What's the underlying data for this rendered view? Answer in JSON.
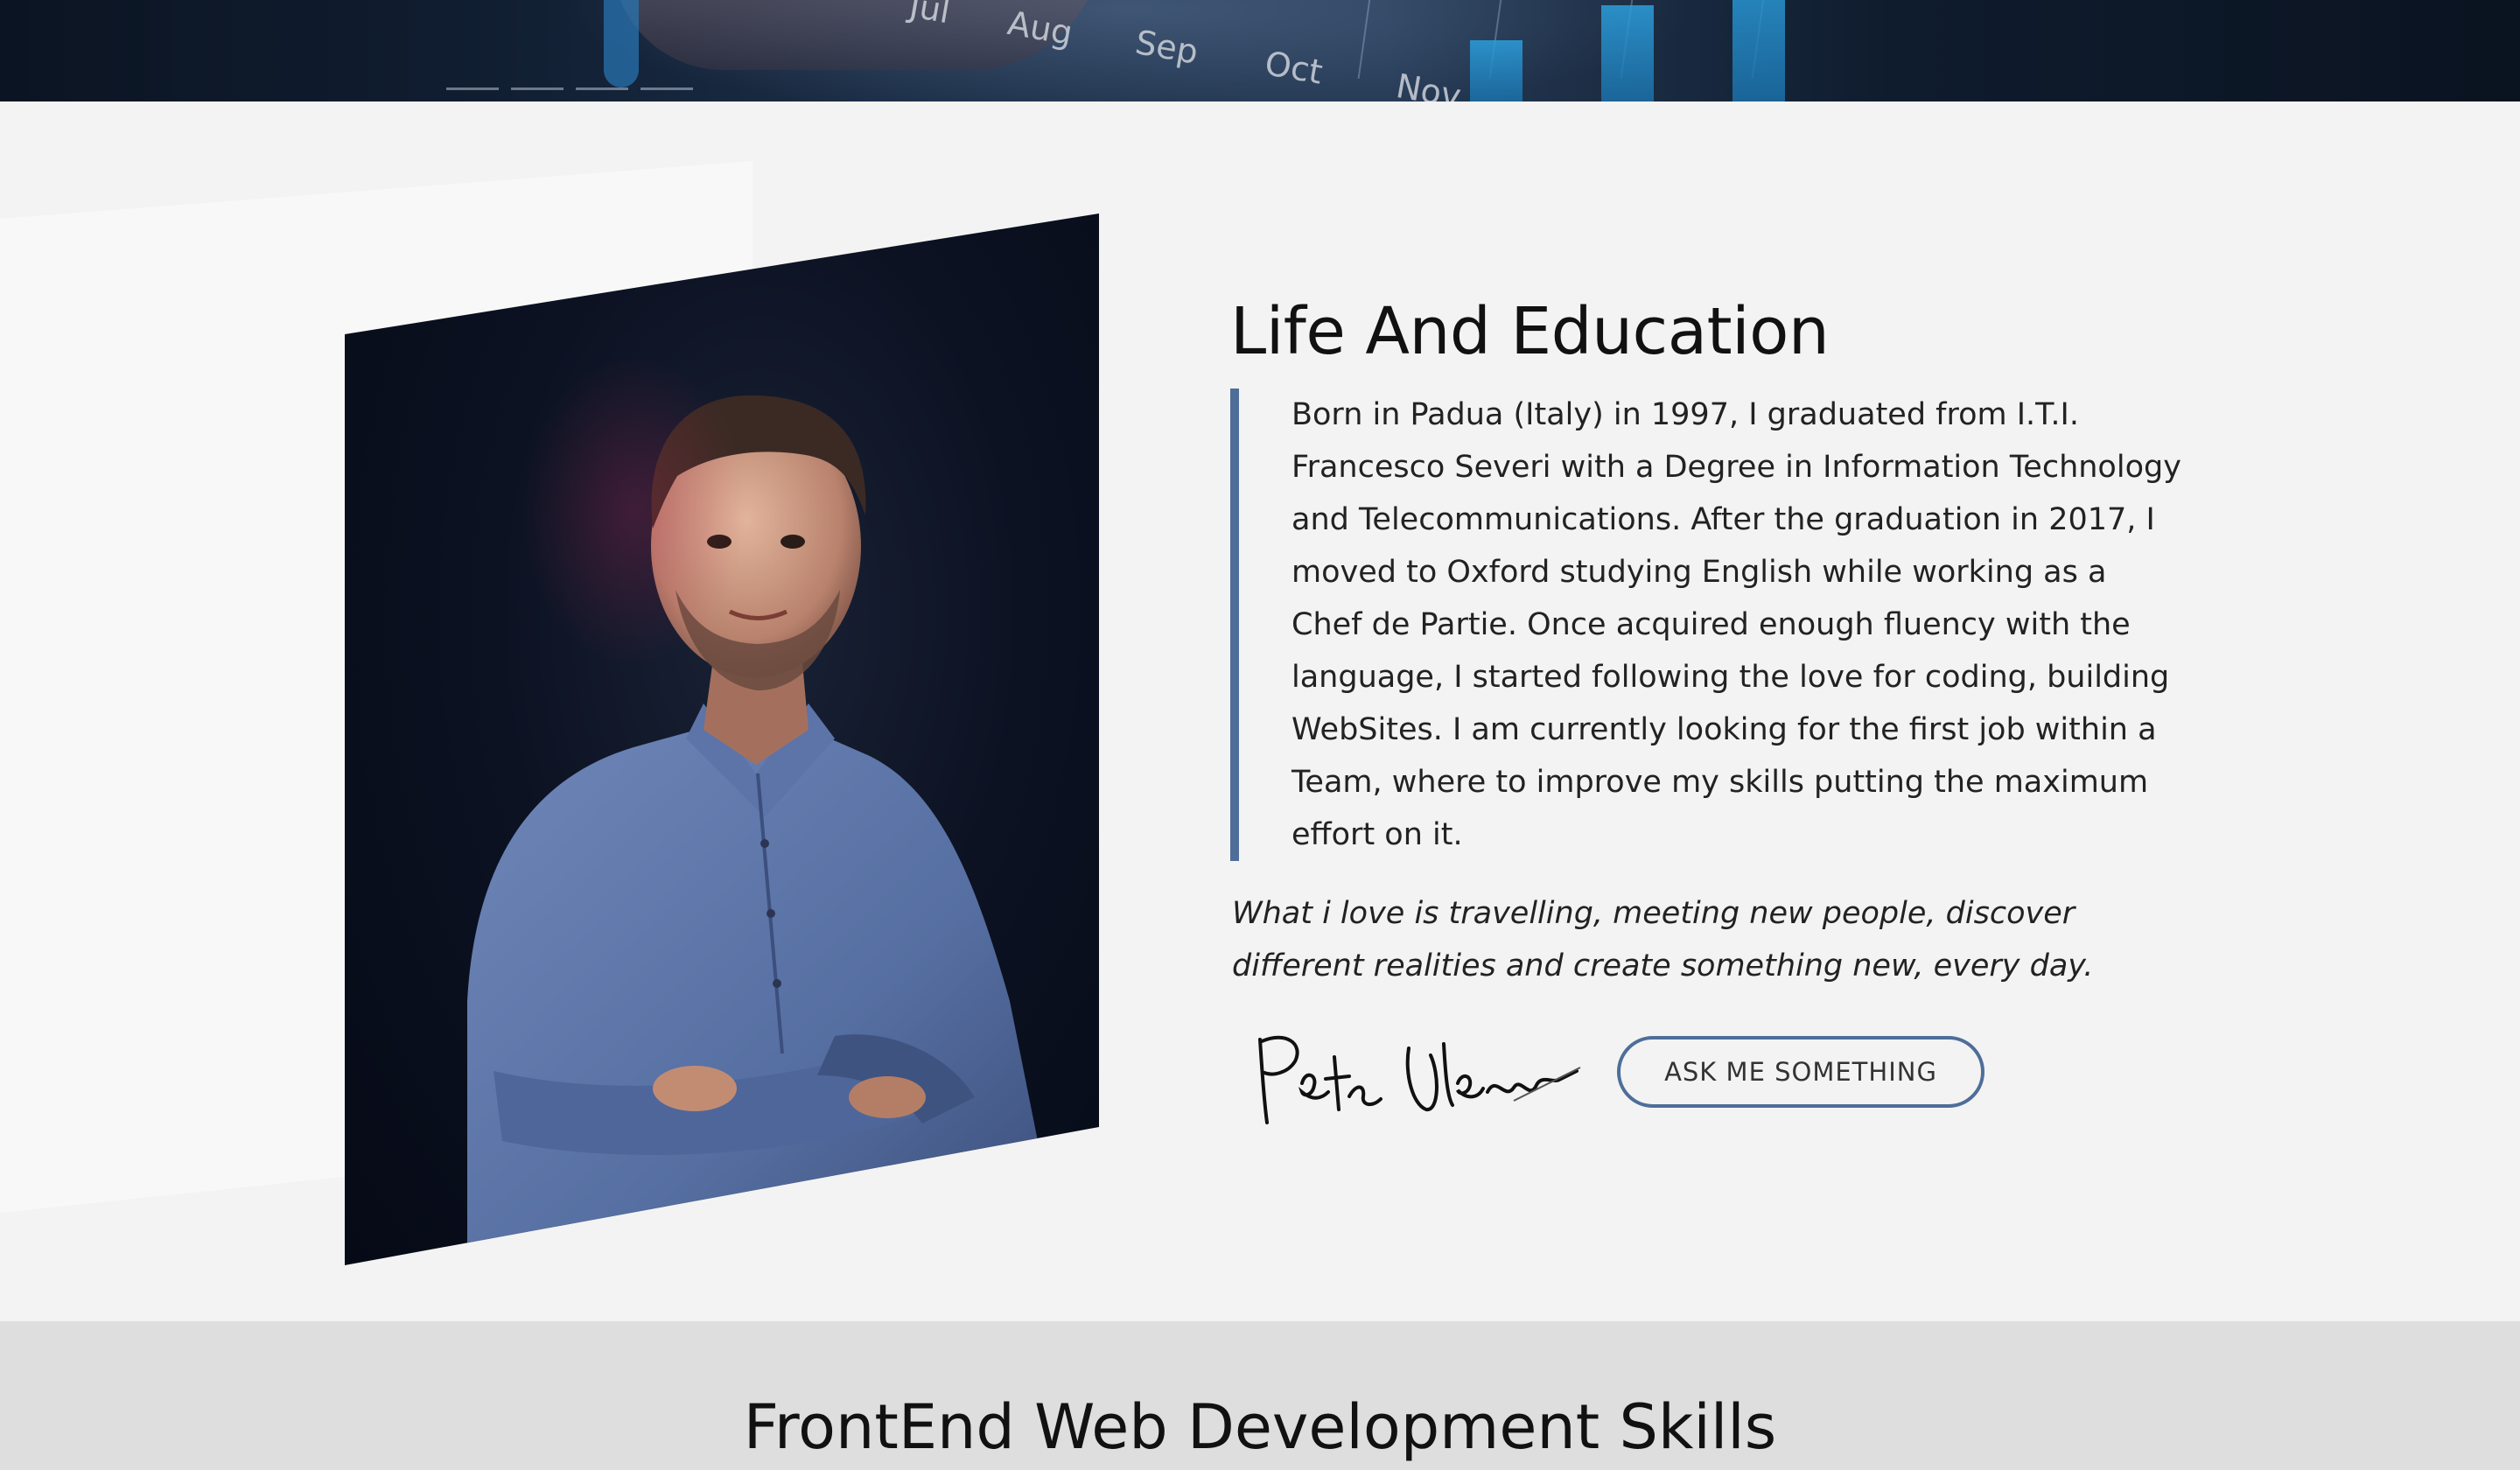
{
  "hero": {
    "months": [
      "Jul",
      "Aug",
      "Sep",
      "Oct",
      "Nov"
    ]
  },
  "about": {
    "title": "Life And Education",
    "bio": "Born in Padua (Italy) in 1997, I graduated from I.T.I. Francesco Severi with a Degree in Information Technology and Telecommunications. After the graduation in 2017, I moved to Oxford studying English while working as a Chef de Partie. Once acquired enough fluency with the language, I started following the love for coding, building WebSites. I am currently looking for the first job within a Team, where to improve my skills putting the maximum effort on it.",
    "love": "What i love is travelling, meeting new people, discover different realities and create something new, every day.",
    "signature": "Peter Vlessio",
    "cta_label": "ASK ME SOMETHING"
  },
  "skills": {
    "title": "FrontEnd Web Development Skills"
  },
  "colors": {
    "accent": "#4e6e99",
    "page_bg": "#f3f3f3",
    "skills_bg": "#dedede",
    "portrait_bg": "#0c1222",
    "shirt": "#5a73a6"
  }
}
